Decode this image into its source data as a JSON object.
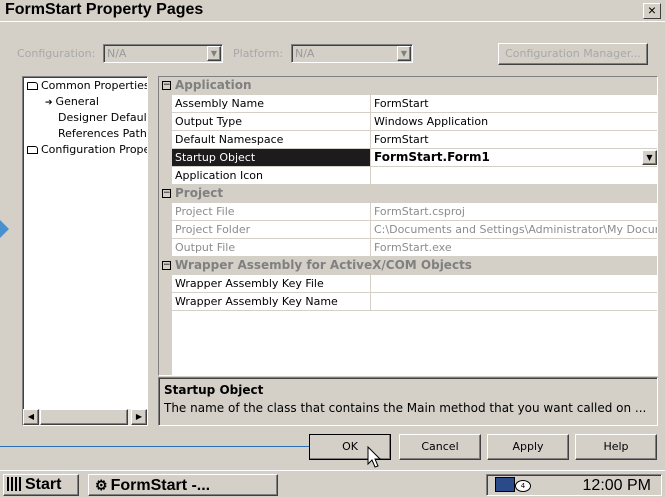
{
  "window": {
    "title": "FormStart Property Pages",
    "close_glyph": "×"
  },
  "toolbar": {
    "configuration_label": "Configuration:",
    "configuration_value": "N/A",
    "platform_label": "Platform:",
    "platform_value": "N/A",
    "config_manager_label": "Configuration Manager..."
  },
  "tree": {
    "items": [
      {
        "label": "Common Properties"
      },
      {
        "label": "General"
      },
      {
        "label": "Designer Defaults"
      },
      {
        "label": "References Path"
      },
      {
        "label": "Configuration Properties"
      }
    ]
  },
  "grid": {
    "categories": [
      {
        "name": "Application",
        "toggle": "⊟"
      },
      {
        "name": "Project",
        "toggle": "⊟"
      },
      {
        "name": "Wrapper Assembly for ActiveX/COM Objects",
        "toggle": "⊟"
      }
    ],
    "application": [
      {
        "name": "Assembly Name",
        "value": "FormStart"
      },
      {
        "name": "Output Type",
        "value": "Windows Application"
      },
      {
        "name": "Default Namespace",
        "value": "FormStart"
      },
      {
        "name": "Startup Object",
        "value": "FormStart.Form1"
      },
      {
        "name": "Application Icon",
        "value": ""
      }
    ],
    "project": [
      {
        "name": "Project File",
        "value": "FormStart.csproj"
      },
      {
        "name": "Project Folder",
        "value": "C:\\Documents and Settings\\Administrator\\My Documents"
      },
      {
        "name": "Output File",
        "value": "FormStart.exe"
      }
    ],
    "wrapper": [
      {
        "name": "Wrapper Assembly Key File",
        "value": ""
      },
      {
        "name": "Wrapper Assembly Key Name",
        "value": ""
      }
    ]
  },
  "description": {
    "title": "Startup Object",
    "text": "The name of the class that contains the Main method that you want called on ..."
  },
  "buttons": {
    "ok": "OK",
    "cancel": "Cancel",
    "apply": "Apply",
    "help": "Help"
  },
  "taskbar": {
    "start_label": "Start",
    "task_label": "FormStart -...",
    "clock": "12:00 PM"
  },
  "colors": {
    "face": "#d4d0c8",
    "selection": "#1c1c1c",
    "callout": "#2a6fb5"
  }
}
